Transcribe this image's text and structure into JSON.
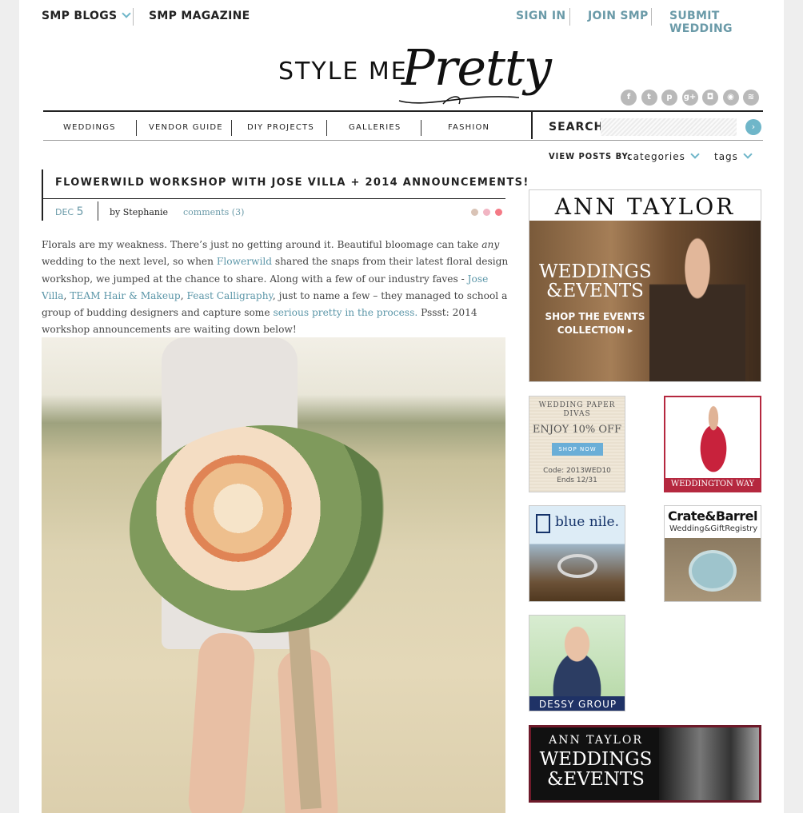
{
  "topnav": {
    "smp_blogs": "SMP BLOGS",
    "smp_magazine": "SMP MAGAZINE",
    "sign_in": "SIGN IN",
    "join_smp": "JOIN SMP",
    "submit_wedding": "SUBMIT WEDDING"
  },
  "logo": {
    "part1": "STYLE ME",
    "part2": "Pretty"
  },
  "social": [
    {
      "icon": "facebook-icon",
      "glyph": "f"
    },
    {
      "icon": "twitter-icon",
      "glyph": "t"
    },
    {
      "icon": "pinterest-icon",
      "glyph": "p"
    },
    {
      "icon": "google-plus-icon",
      "glyph": "g+"
    },
    {
      "icon": "instagram-icon",
      "glyph": "◘"
    },
    {
      "icon": "camera-icon",
      "glyph": "◉"
    },
    {
      "icon": "rss-icon",
      "glyph": "≋"
    }
  ],
  "mainnav": {
    "weddings": "WEDDINGS",
    "vendor_guide": "VENDOR GUIDE",
    "diy_projects": "DIY PROJECTS",
    "galleries": "GALLERIES",
    "fashion": "FASHION"
  },
  "search": {
    "label": "SEARCH",
    "placeholder": ""
  },
  "viewposts": {
    "label": "VIEW POSTS BY:",
    "categories": "categories",
    "tags": "tags"
  },
  "post": {
    "title": "FLOWERWILD WORKSHOP WITH JOSE VILLA + 2014 ANNOUNCEMENTS!",
    "month": "DEC",
    "day": "5",
    "author": "by Stephanie",
    "comments": "comments (3)",
    "body": {
      "t1": "Florals are my weakness. There’s just no getting around it. Beautiful bloomage can take ",
      "em": "any",
      "t2": " wedding to the next level, so when ",
      "l1": "Flowerwild",
      "t3": " shared the snaps from their latest floral design workshop, we jumped at the chance to share. Along with a few of our industry faves - ",
      "l2": "Jose Villa",
      "t4": ", ",
      "l3": "TEAM Hair & Makeup",
      "t5": ", ",
      "l4": "Feast Calligraphy",
      "t6": ", just to name a few – they managed to school a group of budding designers and capture some ",
      "l5": "serious pretty in the process.",
      "t7": " Pssst: 2014 workshop announcements are waiting down below!"
    }
  },
  "ads": {
    "ann_taylor_1": {
      "brand": "ANN TAYLOR",
      "line1": "WEDDINGS",
      "line2": "&EVENTS",
      "cta1": "SHOP THE EVENTS",
      "cta2": "COLLECTION ▸"
    },
    "paper_divas": {
      "line1": "WEDDING PAPER",
      "line2": "DIVAS",
      "offer": "ENJOY 10% OFF",
      "button": "SHOP NOW",
      "code": "Code: 2013WED10",
      "ends": "Ends 12/31"
    },
    "weddington": {
      "brand": "WEDDINGTON WAY"
    },
    "blue_nile": {
      "brand": "blue nile."
    },
    "crate_barrel": {
      "brand": "Crate&Barrel",
      "sub": "Wedding&GiftRegistry"
    },
    "dessy": {
      "brand": "DESSY GROUP"
    },
    "ann_taylor_2": {
      "brand": "ANN TAYLOR",
      "line1": "WEDDINGS",
      "line2": "&EVENTS"
    }
  },
  "colors": {
    "accent": "#6fb6c9",
    "link": "#5b96a8",
    "dot1": "#d9c3b6",
    "dot2": "#f1b5c3",
    "dot3": "#f47a86"
  }
}
